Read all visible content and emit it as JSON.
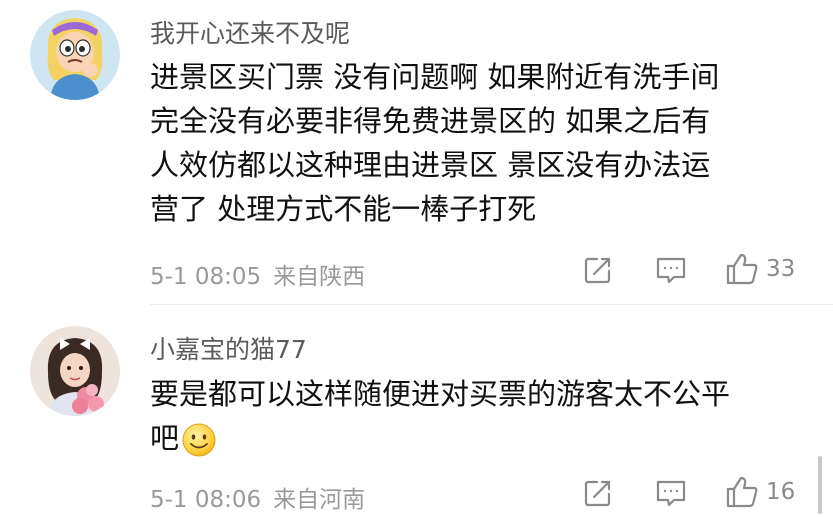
{
  "comments": [
    {
      "username": "我开心还来不及呢",
      "lines": [
        "进景区买门票 没有问题啊  如果附近有洗手间",
        "完全没有必要非得免费进景区的 如果之后有",
        "人效仿都以这种理由进景区 景区没有办法运",
        "营了 处理方式不能一棒子打死"
      ],
      "date": "5-1 08:05",
      "location": "来自陕西",
      "likes": "33",
      "avatar_icon": "cartoon-girl-avatar-icon"
    },
    {
      "username": "小嘉宝的猫77",
      "lines": [
        "要是都可以这样随便进对买票的游客太不公平",
        "吧"
      ],
      "emoji": "smile-emoji-icon",
      "date": "5-1 08:06",
      "location": "来自河南",
      "likes": "16",
      "avatar_icon": "girl-with-flowers-avatar-icon"
    }
  ],
  "colors": {
    "text": "#111111",
    "username": "#5b5b5b",
    "meta": "#9a9a9a",
    "icon": "#8a8a8a",
    "divider": "#ececec"
  }
}
